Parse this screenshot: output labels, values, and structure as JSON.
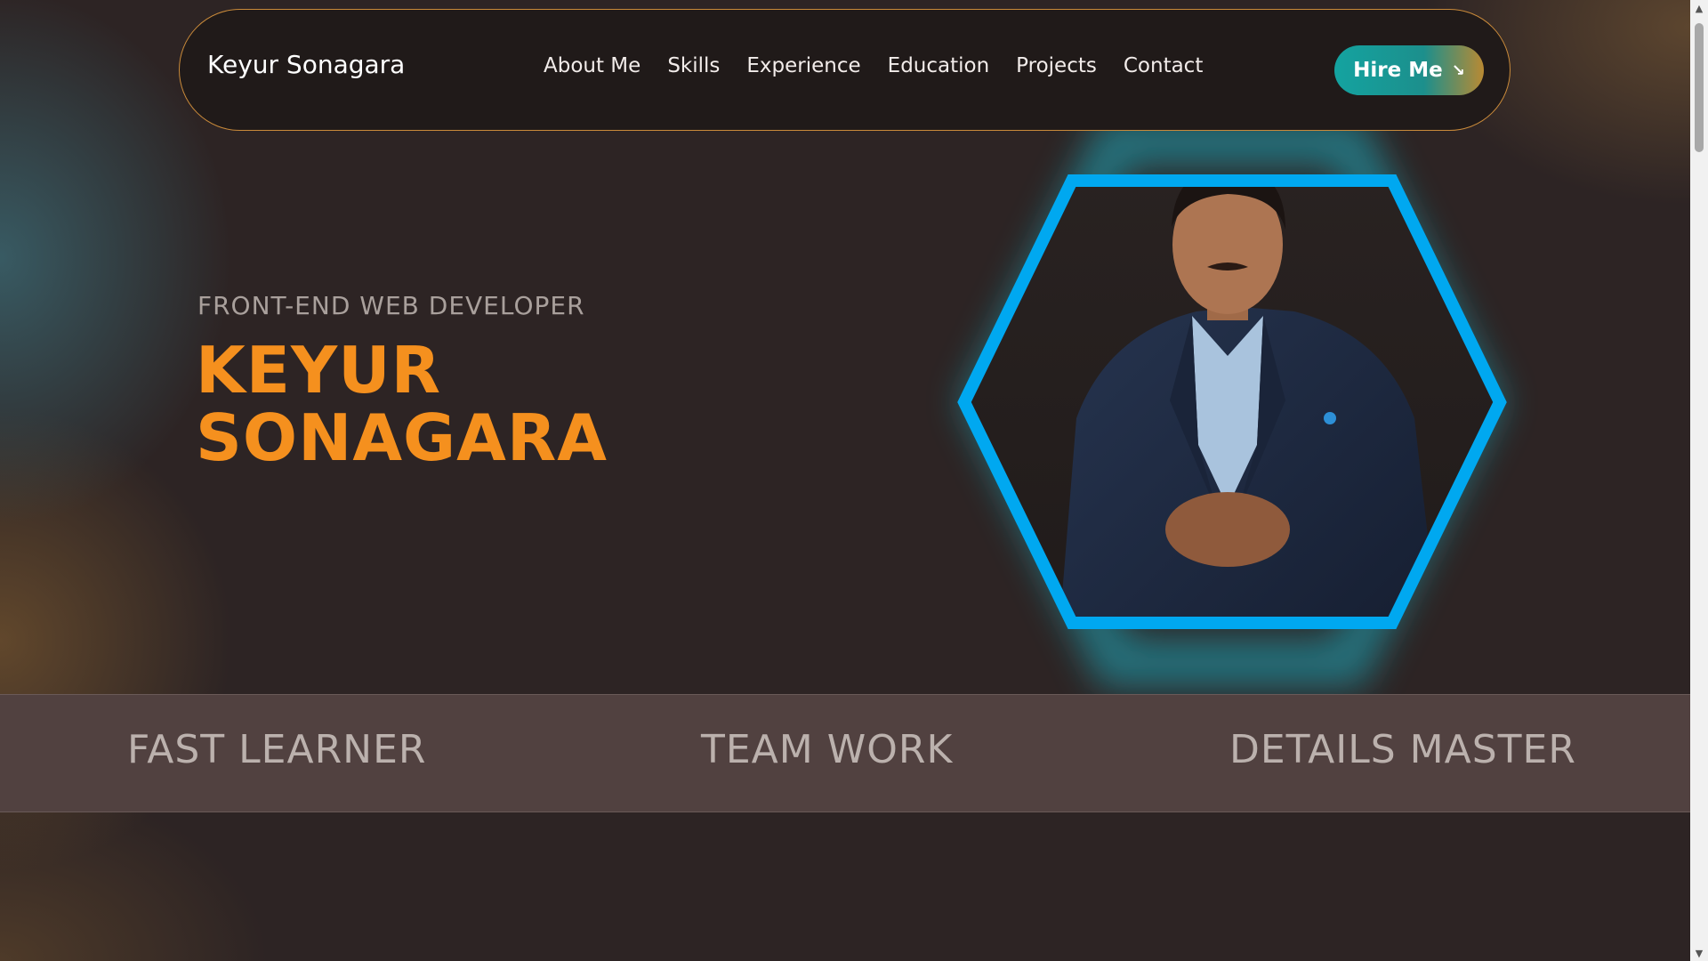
{
  "navbar": {
    "brand": "Keyur Sonagara",
    "links": [
      "About Me",
      "Skills",
      "Experience",
      "Education",
      "Projects",
      "Contact"
    ],
    "hire_label": "Hire Me",
    "hire_icon": "arrow-down-right-icon"
  },
  "hero": {
    "subtitle": "FRONT-END WEB DEVELOPER",
    "name_line1": "KEYUR",
    "name_line2": "SONAGARA"
  },
  "strip": {
    "items": [
      "FAST LEARNER",
      "TEAM WORK",
      "DETAILS MASTER"
    ]
  },
  "colors": {
    "background": "#2d2424",
    "accent_orange": "#f5901e",
    "hex_blue": "#00a8f0",
    "strip_bg": "#514140",
    "nav_border": "#c98a3a"
  }
}
